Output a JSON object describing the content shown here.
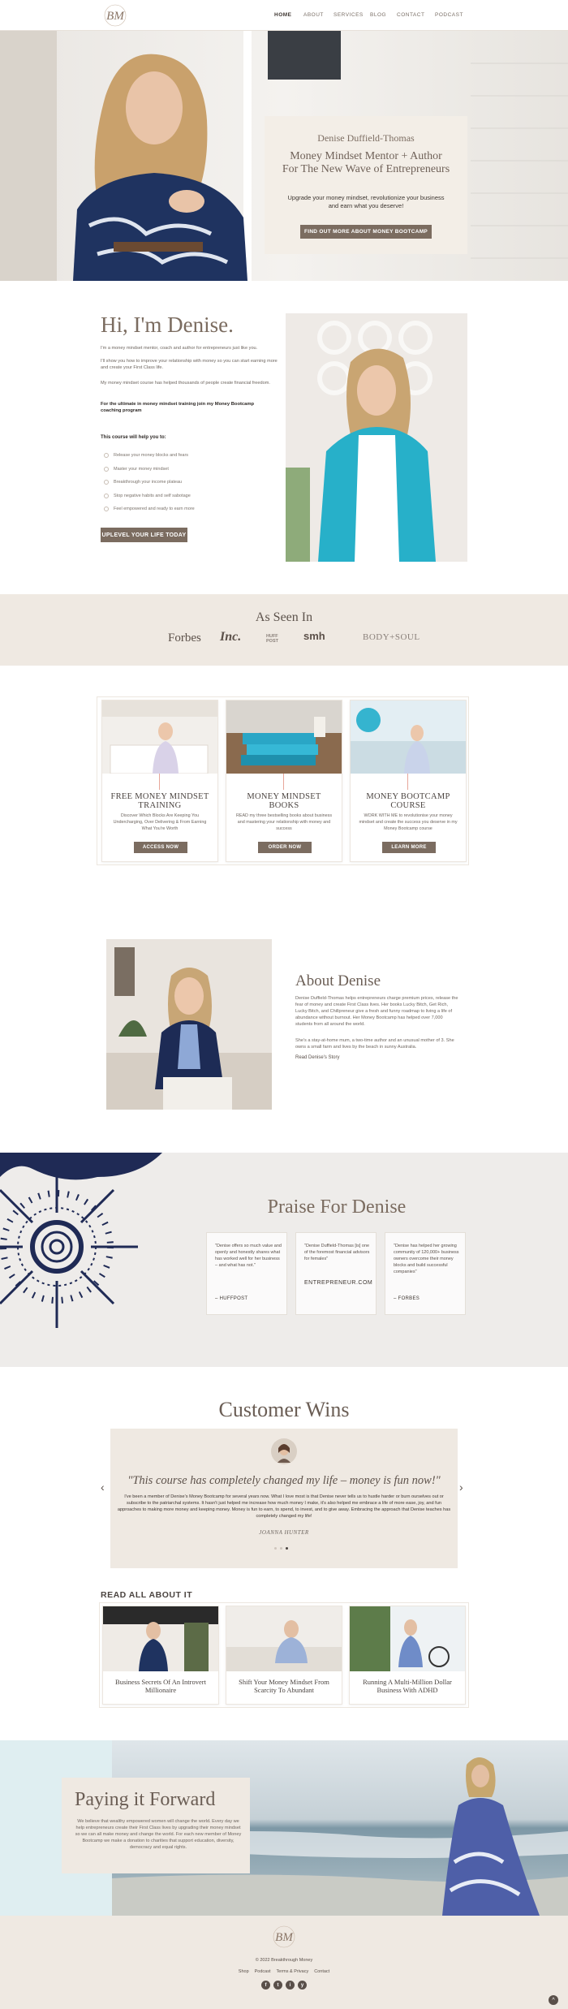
{
  "header": {
    "logo_text": "BM",
    "nav": [
      {
        "label": "HOME"
      },
      {
        "label": "ABOUT"
      },
      {
        "label": "SERVICES"
      },
      {
        "label": "BLOG"
      },
      {
        "label": "CONTACT"
      },
      {
        "label": "PODCAST"
      }
    ]
  },
  "hero": {
    "name": "Denise Duffield-Thomas",
    "title": "Money Mindset Mentor + Author For The New Wave of Entrepreneurs",
    "subtitle": "Upgrade your money mindset, revolutionize your business and earn what you deserve!",
    "button": "FIND OUT MORE ABOUT MONEY BOOTCAMP"
  },
  "intro": {
    "heading": "Hi, I'm Denise.",
    "p1": "I'm a money mindset mentor, coach and author for entrepreneurs just like you.",
    "p2": "I'll show you how to improve your relationship with money so you can start earning more and create your First Class life.",
    "p3": "My money mindset course has helped thousands of people create financial freedom.",
    "p4": "For the ultimate in money mindset training join my Money Bootcamp coaching program",
    "list_title": "This course will help you to:",
    "list": [
      "Release your money blocks and fears",
      "Master your money mindset",
      "Breakthrough your income plateau",
      "Stop negative habits and self sabotage",
      "Feel empowered and ready to earn more"
    ],
    "button": "UPLEVEL YOUR LIFE TODAY"
  },
  "press": {
    "title": "As Seen In",
    "logos": [
      "Forbes",
      "Inc.",
      "HUFF POST",
      "smh",
      "BODY+SOUL"
    ]
  },
  "offers": [
    {
      "title": "FREE MONEY MINDSET TRAINING",
      "text": "Discover Which Blocks Are Keeping You Undercharging, Over Delivering & From Earning What You're Worth",
      "button": "ACCESS NOW"
    },
    {
      "title": "MONEY MINDSET BOOKS",
      "text": "READ my three bestselling books about business and mastering your relationship with money and success",
      "button": "ORDER NOW"
    },
    {
      "title": "MONEY BOOTCAMP COURSE",
      "text": "WORK WITH ME to revolutionise your money mindset and create the success you deserve in my Money Bootcamp course",
      "button": "LEARN MORE"
    }
  ],
  "about": {
    "heading": "About Denise",
    "p1": "Denise Duffield-Thomas helps entrepreneurs charge premium prices, release the fear of money and create First Class lives. Her books Lucky Bitch, Get Rich, Lucky Bitch, and Chillpreneur give a fresh and funny roadmap to living a life of abundance without burnout. Her Money Bootcamp has helped over 7,000 students from all around the world.",
    "p2": "She's a stay-at-home mum, a two-time author and an unusual mother of 3. She owns a small farm and lives by the beach in sunny Australia.",
    "link": "Read Denise's Story"
  },
  "praise": {
    "heading": "Praise For Denise",
    "items": [
      {
        "quote": "\"Denise offers so much value and openly and honestly shares what has worked well for her business – and what has not.\"",
        "source": "– HUFFPOST"
      },
      {
        "quote": "\"Denise Duffield-Thomas [is] one of the foremost financial advisors for females\"",
        "source": "ENTREPRENEUR.COM"
      },
      {
        "quote": "\"Denise has helped her growing community of 120,000+ business owners overcome their money blocks and build successful companies\"",
        "source": "– FORBES"
      }
    ]
  },
  "wins": {
    "heading": "Customer Wins",
    "quote": "\"This course has completely changed my life – money is fun now!\"",
    "text": "I've been a member of Denise's Money Bootcamp for several years now. What I love most is that Denise never tells us to hustle harder or burn ourselves out or subscribe to the patriarchal systems. It hasn't just helped me increase how much money I make, it's also helped me embrace a life of more ease, joy, and fun approaches to making more money and keeping money. Money is fun to earn, to spend, to invest, and to give away. Embracing the approach that Denise teaches has completely changed my life!",
    "author": "JOANNA HUNTER",
    "prev": "‹",
    "next": "›"
  },
  "blog": {
    "heading": "READ ALL ABOUT IT",
    "posts": [
      {
        "title": "Business Secrets Of An Introvert Millionaire"
      },
      {
        "title": "Shift Your Money Mindset From Scarcity To Abundant"
      },
      {
        "title": "Running A Multi-Million Dollar Business With ADHD"
      }
    ]
  },
  "forward": {
    "heading": "Paying it Forward",
    "text": "We believe that wealthy empowered women will change the world. Every day we help entrepreneurs create their First Class lives by upgrading their money mindset so we can all make money and change the world. For each new member of Money Bootcamp we make a donation to charities that support education, diversity, democracy and equal rights."
  },
  "footer": {
    "logo_text": "BM",
    "copyright": "© 2022 Breakthrough Money",
    "links": [
      "Shop",
      "Podcast",
      "Terms & Privacy",
      "Contact"
    ],
    "social": [
      "f",
      "t",
      "i",
      "y"
    ]
  },
  "colors": {
    "accent": "#7b6c60",
    "beige": "#efe9e2",
    "navy": "#1f2a55"
  }
}
